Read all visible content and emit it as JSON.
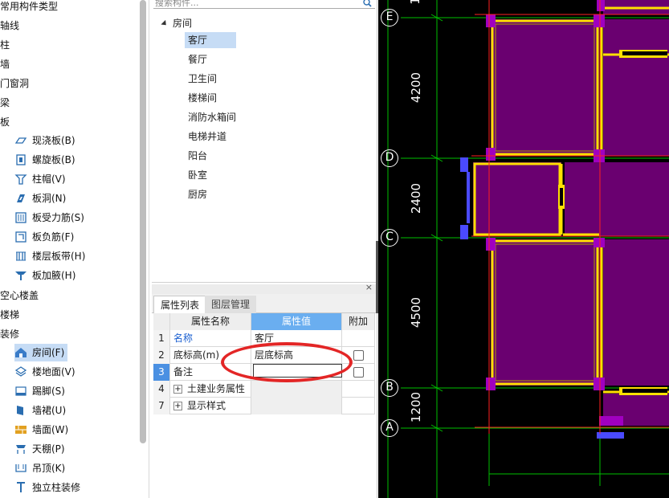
{
  "left_nav": {
    "items": [
      {
        "label": "常用构件类型"
      },
      {
        "label": "轴线"
      },
      {
        "label": "柱"
      },
      {
        "label": "墙"
      },
      {
        "label": "门窗洞"
      },
      {
        "label": "梁"
      },
      {
        "label": "板"
      }
    ],
    "board_children": [
      {
        "label": "现浇板(B)",
        "icon": "slab-icon"
      },
      {
        "label": "螺旋板(B)",
        "icon": "spiral-slab-icon"
      },
      {
        "label": "柱帽(V)",
        "icon": "column-cap-icon"
      },
      {
        "label": "板洞(N)",
        "icon": "slab-hole-icon"
      },
      {
        "label": "板受力筋(S)",
        "icon": "slab-rebar-icon"
      },
      {
        "label": "板负筋(F)",
        "icon": "negative-rebar-icon"
      },
      {
        "label": "楼层板带(H)",
        "icon": "floor-strip-icon"
      },
      {
        "label": "板加腋(H)",
        "icon": "slab-haunch-icon"
      }
    ],
    "items2": [
      {
        "label": "空心楼盖"
      },
      {
        "label": "楼梯"
      },
      {
        "label": "装修"
      }
    ],
    "deco_children": [
      {
        "label": "房间(F)",
        "icon": "room-icon",
        "selected": true
      },
      {
        "label": "楼地面(V)",
        "icon": "floor-icon"
      },
      {
        "label": "踢脚(S)",
        "icon": "skirting-icon"
      },
      {
        "label": "墙裙(U)",
        "icon": "dado-icon"
      },
      {
        "label": "墙面(W)",
        "icon": "wall-surface-icon"
      },
      {
        "label": "天棚(P)",
        "icon": "ceiling-icon"
      },
      {
        "label": "吊顶(K)",
        "icon": "suspended-ceiling-icon"
      },
      {
        "label": "独立柱装修",
        "icon": "column-deco-icon"
      }
    ]
  },
  "search": {
    "placeholder": "搜索构件..."
  },
  "tree": {
    "root": "房间",
    "items": [
      "客厅",
      "餐厅",
      "卫生间",
      "楼梯间",
      "消防水箱间",
      "电梯井道",
      "阳台",
      "卧室",
      "厨房"
    ],
    "selected_index": 0
  },
  "props": {
    "close_glyph": "×",
    "tabs": [
      "属性列表",
      "图层管理"
    ],
    "headers": [
      "属性名称",
      "属性值",
      "附加"
    ],
    "rows": [
      {
        "num": "1",
        "name": "名称",
        "value": "客厅"
      },
      {
        "num": "2",
        "name": "底标高(m)",
        "value": "层底标高"
      },
      {
        "num": "3",
        "name": "备注",
        "value": ""
      },
      {
        "num": "4",
        "name": "土建业务属性",
        "value": ""
      },
      {
        "num": "7",
        "name": "显示样式",
        "value": ""
      }
    ],
    "plus_glyph": "+"
  },
  "cad": {
    "axes": [
      "E",
      "D",
      "C",
      "B",
      "A"
    ],
    "dims": [
      "4200",
      "2400",
      "4500",
      "1200"
    ],
    "top_partial": "1",
    "colors": {
      "background": "#000000",
      "grid": "#00c000",
      "wall": "#ffe000",
      "room": "#6a0070",
      "column": "#a000c0",
      "redline": "#ff2020"
    }
  }
}
